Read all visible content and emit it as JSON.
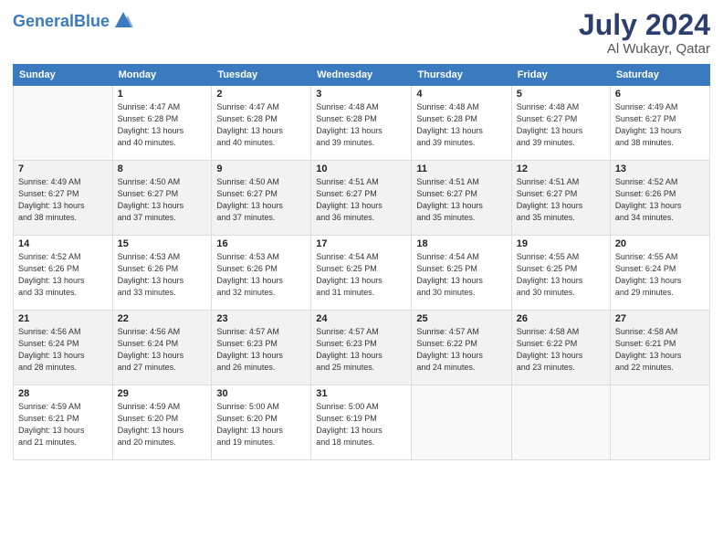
{
  "app": {
    "logo_line1": "General",
    "logo_line2": "Blue"
  },
  "calendar": {
    "month": "July 2024",
    "location": "Al Wukayr, Qatar",
    "headers": [
      "Sunday",
      "Monday",
      "Tuesday",
      "Wednesday",
      "Thursday",
      "Friday",
      "Saturday"
    ],
    "weeks": [
      [
        {
          "day": "",
          "info": ""
        },
        {
          "day": "1",
          "info": "Sunrise: 4:47 AM\nSunset: 6:28 PM\nDaylight: 13 hours\nand 40 minutes."
        },
        {
          "day": "2",
          "info": "Sunrise: 4:47 AM\nSunset: 6:28 PM\nDaylight: 13 hours\nand 40 minutes."
        },
        {
          "day": "3",
          "info": "Sunrise: 4:48 AM\nSunset: 6:28 PM\nDaylight: 13 hours\nand 39 minutes."
        },
        {
          "day": "4",
          "info": "Sunrise: 4:48 AM\nSunset: 6:28 PM\nDaylight: 13 hours\nand 39 minutes."
        },
        {
          "day": "5",
          "info": "Sunrise: 4:48 AM\nSunset: 6:27 PM\nDaylight: 13 hours\nand 39 minutes."
        },
        {
          "day": "6",
          "info": "Sunrise: 4:49 AM\nSunset: 6:27 PM\nDaylight: 13 hours\nand 38 minutes."
        }
      ],
      [
        {
          "day": "7",
          "info": "Sunrise: 4:49 AM\nSunset: 6:27 PM\nDaylight: 13 hours\nand 38 minutes."
        },
        {
          "day": "8",
          "info": "Sunrise: 4:50 AM\nSunset: 6:27 PM\nDaylight: 13 hours\nand 37 minutes."
        },
        {
          "day": "9",
          "info": "Sunrise: 4:50 AM\nSunset: 6:27 PM\nDaylight: 13 hours\nand 37 minutes."
        },
        {
          "day": "10",
          "info": "Sunrise: 4:51 AM\nSunset: 6:27 PM\nDaylight: 13 hours\nand 36 minutes."
        },
        {
          "day": "11",
          "info": "Sunrise: 4:51 AM\nSunset: 6:27 PM\nDaylight: 13 hours\nand 35 minutes."
        },
        {
          "day": "12",
          "info": "Sunrise: 4:51 AM\nSunset: 6:27 PM\nDaylight: 13 hours\nand 35 minutes."
        },
        {
          "day": "13",
          "info": "Sunrise: 4:52 AM\nSunset: 6:26 PM\nDaylight: 13 hours\nand 34 minutes."
        }
      ],
      [
        {
          "day": "14",
          "info": "Sunrise: 4:52 AM\nSunset: 6:26 PM\nDaylight: 13 hours\nand 33 minutes."
        },
        {
          "day": "15",
          "info": "Sunrise: 4:53 AM\nSunset: 6:26 PM\nDaylight: 13 hours\nand 33 minutes."
        },
        {
          "day": "16",
          "info": "Sunrise: 4:53 AM\nSunset: 6:26 PM\nDaylight: 13 hours\nand 32 minutes."
        },
        {
          "day": "17",
          "info": "Sunrise: 4:54 AM\nSunset: 6:25 PM\nDaylight: 13 hours\nand 31 minutes."
        },
        {
          "day": "18",
          "info": "Sunrise: 4:54 AM\nSunset: 6:25 PM\nDaylight: 13 hours\nand 30 minutes."
        },
        {
          "day": "19",
          "info": "Sunrise: 4:55 AM\nSunset: 6:25 PM\nDaylight: 13 hours\nand 30 minutes."
        },
        {
          "day": "20",
          "info": "Sunrise: 4:55 AM\nSunset: 6:24 PM\nDaylight: 13 hours\nand 29 minutes."
        }
      ],
      [
        {
          "day": "21",
          "info": "Sunrise: 4:56 AM\nSunset: 6:24 PM\nDaylight: 13 hours\nand 28 minutes."
        },
        {
          "day": "22",
          "info": "Sunrise: 4:56 AM\nSunset: 6:24 PM\nDaylight: 13 hours\nand 27 minutes."
        },
        {
          "day": "23",
          "info": "Sunrise: 4:57 AM\nSunset: 6:23 PM\nDaylight: 13 hours\nand 26 minutes."
        },
        {
          "day": "24",
          "info": "Sunrise: 4:57 AM\nSunset: 6:23 PM\nDaylight: 13 hours\nand 25 minutes."
        },
        {
          "day": "25",
          "info": "Sunrise: 4:57 AM\nSunset: 6:22 PM\nDaylight: 13 hours\nand 24 minutes."
        },
        {
          "day": "26",
          "info": "Sunrise: 4:58 AM\nSunset: 6:22 PM\nDaylight: 13 hours\nand 23 minutes."
        },
        {
          "day": "27",
          "info": "Sunrise: 4:58 AM\nSunset: 6:21 PM\nDaylight: 13 hours\nand 22 minutes."
        }
      ],
      [
        {
          "day": "28",
          "info": "Sunrise: 4:59 AM\nSunset: 6:21 PM\nDaylight: 13 hours\nand 21 minutes."
        },
        {
          "day": "29",
          "info": "Sunrise: 4:59 AM\nSunset: 6:20 PM\nDaylight: 13 hours\nand 20 minutes."
        },
        {
          "day": "30",
          "info": "Sunrise: 5:00 AM\nSunset: 6:20 PM\nDaylight: 13 hours\nand 19 minutes."
        },
        {
          "day": "31",
          "info": "Sunrise: 5:00 AM\nSunset: 6:19 PM\nDaylight: 13 hours\nand 18 minutes."
        },
        {
          "day": "",
          "info": ""
        },
        {
          "day": "",
          "info": ""
        },
        {
          "day": "",
          "info": ""
        }
      ]
    ]
  }
}
